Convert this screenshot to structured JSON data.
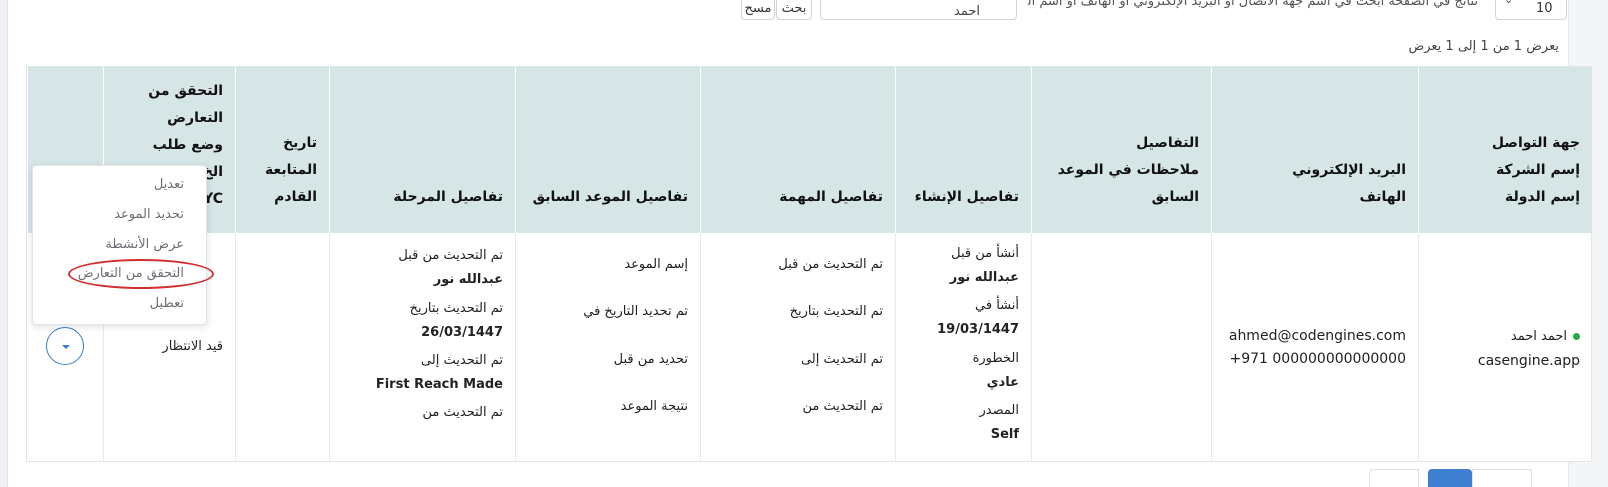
{
  "toolbar": {
    "clear_label": "مسح",
    "search_label": "بحث",
    "search_value": "احمد",
    "search_hint": "نتائج في الصفحة ابحث في اسم جهة الاتصال أو البريد الإلكتروني أو الهاتف أو اسم الشركة.",
    "page_size": "10"
  },
  "summary": {
    "showing_text": "يعرض 1 من 1 إلى 1 يعرض"
  },
  "table": {
    "headers": {
      "contact": [
        "جهة التواصل",
        "إسم الشركة",
        "إسم الدولة"
      ],
      "email_phone": [
        "البريد الإلكتروني",
        "الهاتف"
      ],
      "details": [
        "التفاصيل",
        "ملاحظات في الموعد",
        "السابق"
      ],
      "creation": [
        "تفاصيل الإنشاء"
      ],
      "task": [
        "تفاصيل المهمة"
      ],
      "prev_appt": [
        "تفاصيل الموعد السابق"
      ],
      "stage": [
        "تفاصيل المرحلة"
      ],
      "followup": [
        "تاريخ",
        "المتابعة",
        "القادم"
      ],
      "kyc": [
        "التحقق من",
        "التعارض",
        "وضع طلب",
        "الخ",
        "YC"
      ]
    },
    "row": {
      "contact_name": "احمد احمد",
      "company": "casengine.app",
      "email": "ahmed@codengines.com",
      "phone": "+971 000000000000000",
      "created_by_label": "أنشأ من قبل",
      "created_by": "عبدالله نور",
      "created_on_label": "أنشأ في",
      "created_on": "19/03/1447",
      "severity_label": "الخطورة",
      "severity": "عادي",
      "source_label": "المصدر",
      "source": "Self",
      "task_updated_by": "تم التحديث من قبل",
      "task_updated_on": "تم التحديث بتاريخ",
      "task_updated_to": "تم التحديث إلى",
      "task_updated_from": "تم التحديث من",
      "appt_name": "إسم الموعد",
      "appt_date": "تم تحديد التاريخ في",
      "appt_set_by": "تحديد من قبل",
      "appt_result": "نتيجة الموعد",
      "stage_updated_by_label": "تم التحديث من قبل",
      "stage_updated_by": "عبدالله نور",
      "stage_updated_on_label": "تم التحديث بتاريخ",
      "stage_updated_on": "26/03/1447",
      "stage_updated_to_label": "تم التحديث إلى",
      "stage_updated_to": "First Reach Made",
      "stage_updated_from_label": "تم التحديث من",
      "kyc_status": "قيد الانتظار"
    }
  },
  "menu": {
    "items": [
      "تعديل",
      "تحديد الموعد",
      "عرض الأنشطة",
      "التحقق من التعارض",
      "تعطيل"
    ],
    "highlighted_index": 3
  },
  "colors": {
    "header_bg": "#d6e6e7",
    "accent": "#3f7fd1",
    "highlight": "#d32f2f",
    "status_dot": "#27a843"
  }
}
